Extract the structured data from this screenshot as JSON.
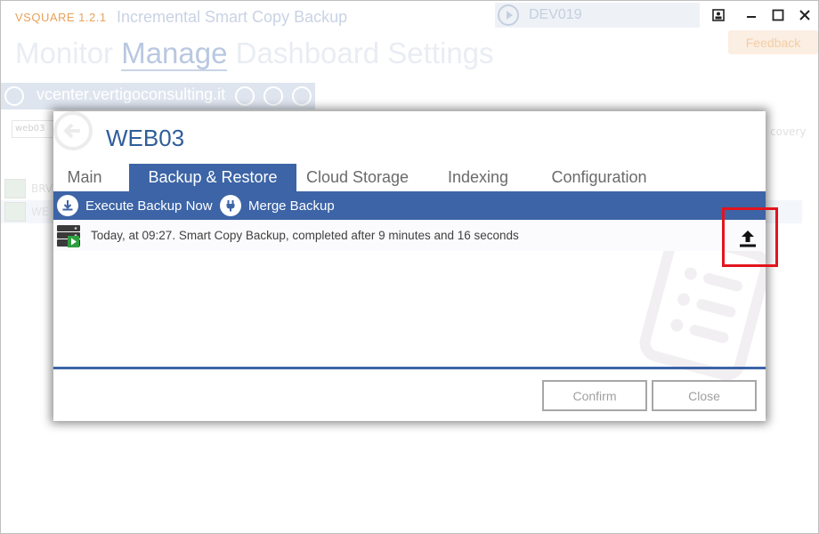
{
  "app": {
    "name": "VSQUARE 1.2.1",
    "subtitle": "Incremental Smart Copy Backup",
    "server": "DEV019",
    "feedback_label": "Feedback",
    "nav": {
      "item_1": "Monitor",
      "item_active": "Manage",
      "item_3": "Dashboard",
      "item_4": "Settings"
    },
    "vcenter_label": "vcenter.vertigoconsulting.it",
    "filter_value": "web03",
    "bg_rows": [
      "BRV",
      "WE"
    ],
    "bg_recovery_label": "covery"
  },
  "window_controls": [
    "screenshot-icon",
    "minimize-icon",
    "maximize-icon",
    "close-icon"
  ],
  "modal": {
    "title": "WEB03",
    "tabs": [
      {
        "label": "Main",
        "active": false
      },
      {
        "label": "Backup & Restore",
        "active": true
      },
      {
        "label": "Cloud Storage",
        "active": false
      },
      {
        "label": "Indexing",
        "active": false
      },
      {
        "label": "Configuration",
        "active": false
      }
    ],
    "toolbar": {
      "execute_label": "Execute Backup Now",
      "merge_label": "Merge Backup"
    },
    "backups": [
      {
        "text": "Today, at 09:27. Smart Copy Backup, completed after 9 minutes and 16 seconds",
        "icon": "server-backup-icon"
      }
    ],
    "footer": {
      "confirm_label": "Confirm",
      "close_label": "Close"
    }
  },
  "colors": {
    "accent": "#3c64a6",
    "highlight": "#e3141d",
    "title": "#2f5d9a"
  }
}
